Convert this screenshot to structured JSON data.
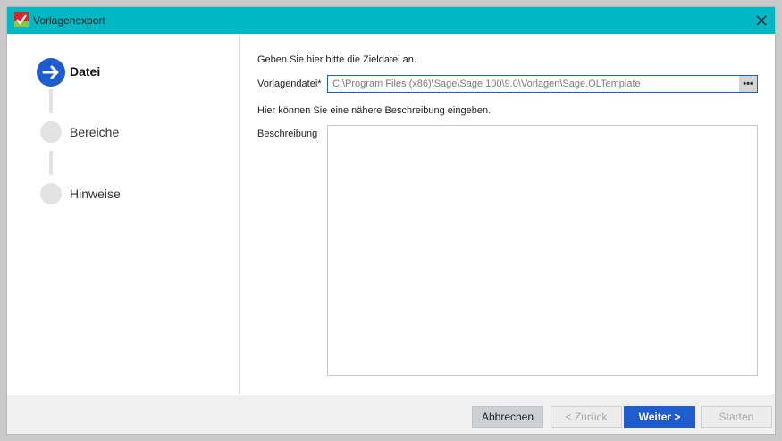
{
  "window": {
    "title": "Vorlagenexport"
  },
  "steps": [
    {
      "label": "Datei",
      "state": "active"
    },
    {
      "label": "Bereiche",
      "state": "inactive"
    },
    {
      "label": "Hinweise",
      "state": "inactive"
    }
  ],
  "form": {
    "intro": "Geben Sie hier bitte die Zieldatei an.",
    "file_label": "Vorlagendatei*",
    "file_value": "C:\\Program Files (x86)\\Sage\\Sage 100\\9.0\\Vorlagen\\Sage.OLTemplate",
    "browse_label": "•••",
    "desc_intro": "Hier können Sie eine nähere Beschreibung eingeben.",
    "desc_label": "Beschreibung",
    "desc_value": ""
  },
  "footer": {
    "cancel": "Abbrechen",
    "back": "< Zurück",
    "next": "Weiter >",
    "start": "Starten"
  },
  "colors": {
    "titlebar": "#00b7c3",
    "accent": "#1f5dcf",
    "step_inactive": "#e3e3e3"
  },
  "icons": {
    "app": "sage-template-export-icon",
    "close": "close-icon",
    "step_active": "arrow-right-icon"
  }
}
